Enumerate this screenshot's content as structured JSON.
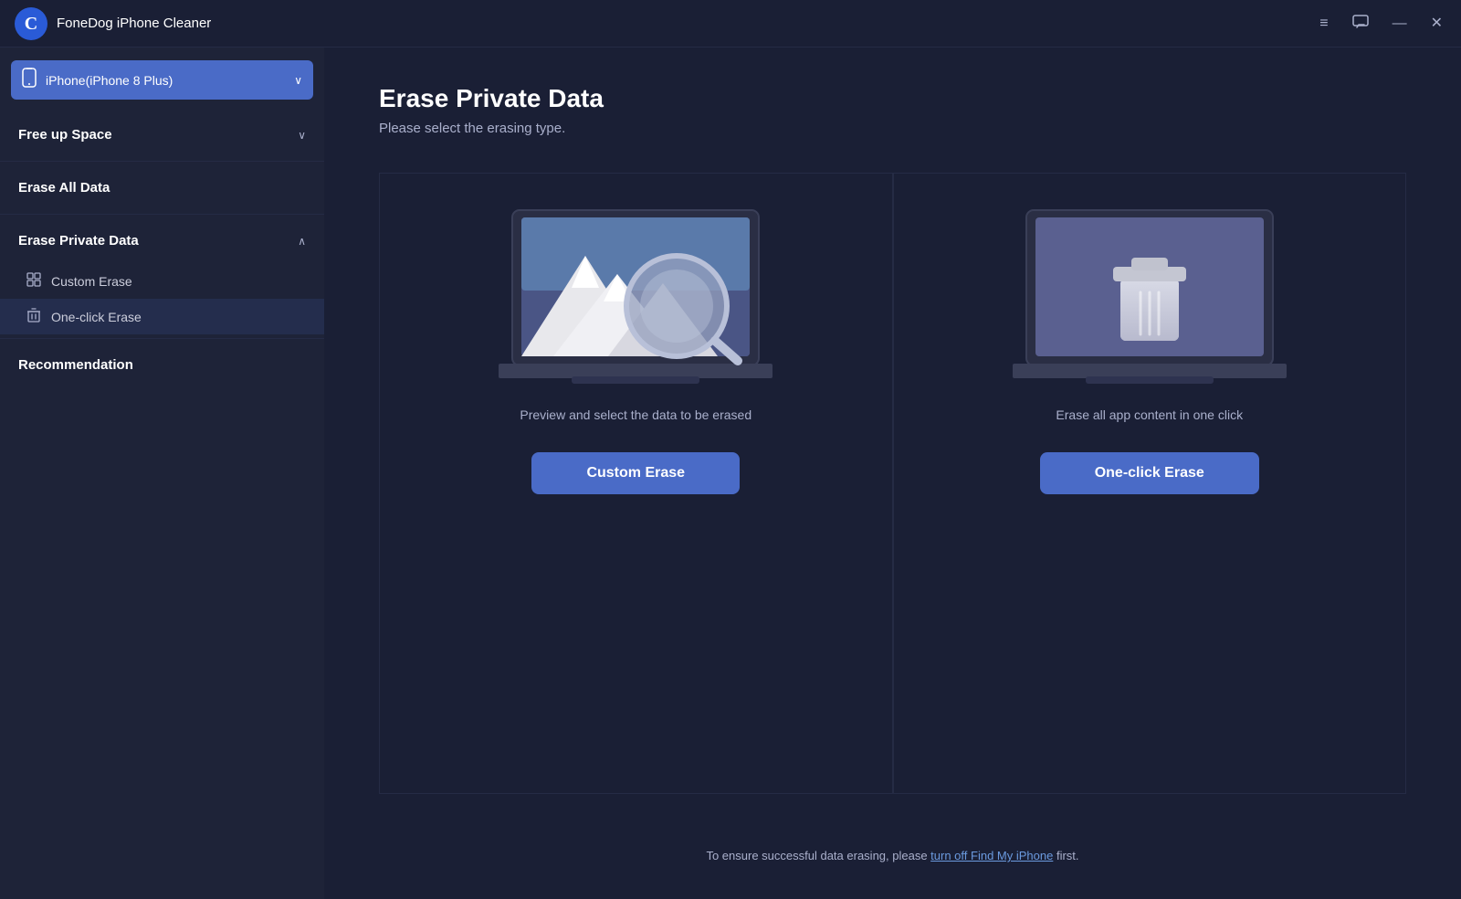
{
  "titlebar": {
    "title": "FoneDog iPhone Cleaner",
    "logo_letter": "C"
  },
  "device_selector": {
    "name": "iPhone(iPhone 8 Plus)",
    "icon": "📱"
  },
  "sidebar": {
    "sections": [
      {
        "id": "free-up-space",
        "title": "Free up Space",
        "expanded": false,
        "chevron": "∨"
      },
      {
        "id": "erase-all-data",
        "title": "Erase All Data",
        "expanded": false
      },
      {
        "id": "erase-private-data",
        "title": "Erase Private Data",
        "expanded": true,
        "chevron": "∧",
        "items": [
          {
            "id": "custom-erase",
            "label": "Custom Erase",
            "icon": "grid"
          },
          {
            "id": "one-click-erase",
            "label": "One-click Erase",
            "icon": "trash"
          }
        ]
      },
      {
        "id": "recommendation",
        "title": "Recommendation",
        "expanded": false
      }
    ]
  },
  "main": {
    "page_title": "Erase Private Data",
    "page_subtitle": "Please select the erasing type.",
    "cards": [
      {
        "id": "custom-erase",
        "description": "Preview and select the data to be erased",
        "button_label": "Custom Erase"
      },
      {
        "id": "one-click-erase",
        "description": "Erase all app content in one click",
        "button_label": "One-click Erase"
      }
    ],
    "footer_note_prefix": "To ensure successful data erasing, please ",
    "footer_note_link": "turn off Find My iPhone",
    "footer_note_suffix": " first."
  },
  "icons": {
    "minimize": "—",
    "maximize": "□",
    "close": "✕",
    "menu": "≡",
    "chat": "💬"
  }
}
